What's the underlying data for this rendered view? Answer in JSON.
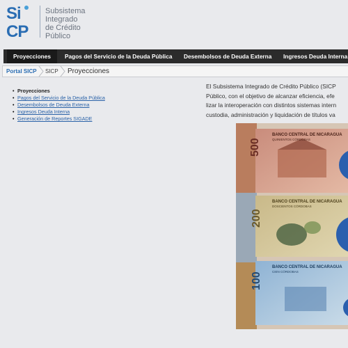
{
  "header": {
    "logo_line1": "Si",
    "logo_line2": "CP",
    "org_lines": [
      "Subsistema",
      "Integrado",
      "de Crédito",
      "Público"
    ]
  },
  "nav": {
    "items": [
      {
        "label": "Proyecciones",
        "active": true
      },
      {
        "label": "Pagos del Servicio de la Deuda Pública",
        "active": false
      },
      {
        "label": "Desembolsos de Deuda Externa",
        "active": false
      },
      {
        "label": "Ingresos Deuda Interna",
        "active": false
      }
    ]
  },
  "breadcrumb": {
    "items": [
      "Portal SICP",
      "SICP",
      "Proyecciones"
    ]
  },
  "sidebar_menu": {
    "heading": "Proyecciones",
    "links": [
      "Pagos del Servicio de la Deuda Pública",
      "Desembolsos de Deuda Externa",
      "Ingresos Deuda Interna",
      "Generación de Reportes SIGADE"
    ]
  },
  "intro": {
    "lines": [
      "El Subsistema Integrado de Crédito Público (SICP",
      "Público, con el objetivo de alcanzar eficiencia, efe",
      "lizar la interoperación con distintos sistemas intern",
      "custodia, administración y liquidación de títulos va"
    ]
  },
  "banknotes": {
    "bank_name": "BANCO CENTRAL DE NICARAGUA",
    "notes": [
      {
        "value": "500",
        "words": "QUINIENTOS CÓRDOBAS"
      },
      {
        "value": "200",
        "words": "DOSCIENTOS CÓRDOBAS"
      },
      {
        "value": "100",
        "words": "CIEN CÓRDOBAS"
      }
    ]
  },
  "colors": {
    "brand_blue": "#2a6db3",
    "nav_bg": "#2b2b2b",
    "link": "#2a62a8"
  }
}
